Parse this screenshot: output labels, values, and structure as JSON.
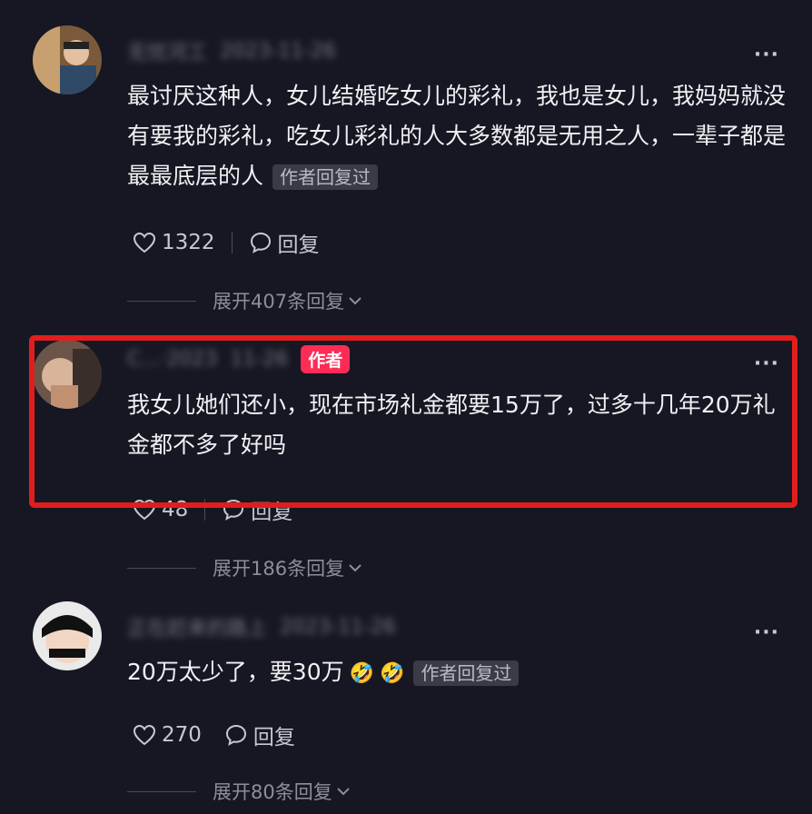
{
  "comments": [
    {
      "username": "无忧河工",
      "date": "2023-11-26",
      "text": "最讨厌这种人，女儿结婚吃女儿的彩礼，我也是女儿，我妈妈就没有要我的彩礼，吃女儿彩礼的人大多数都是无用之人，一辈子都是最最底层的人",
      "reply_tag": "作者回复过",
      "likes": "1322",
      "reply_label": "回复",
      "expand_label": "展开407条回复"
    },
    {
      "username": "C...·2023",
      "date": "11-26",
      "author_badge": "作者",
      "text": "我女儿她们还小，现在市场礼金都要15万了，过多十几年20万礼金都不多了好吗",
      "likes": "48",
      "reply_label": "回复",
      "expand_label": "展开186条回复"
    },
    {
      "username": "正在赶来的路上",
      "date": "2023-11-26",
      "text": "20万太少了，要30万",
      "emojis": [
        "🤣",
        "🤣"
      ],
      "reply_tag": "作者回复过",
      "likes": "270",
      "reply_label": "回复",
      "expand_label": "展开80条回复"
    }
  ],
  "more_glyph": "···",
  "colors": {
    "background": "#161722",
    "badge": "#fe2c55",
    "highlight": "#e01e1e"
  }
}
